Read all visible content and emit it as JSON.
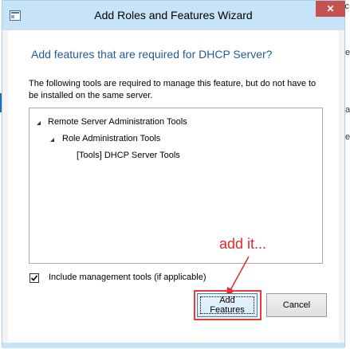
{
  "window": {
    "title": "Add Roles and Features Wizard",
    "close_glyph": "✕"
  },
  "dialog": {
    "heading": "Add features that are required for DHCP Server?",
    "description": "The following tools are required to manage this feature, but do not have to be installed on the same server.",
    "tree": [
      {
        "label": "Remote Server Administration Tools",
        "expanded": true
      },
      {
        "label": "Role Administration Tools",
        "expanded": true
      },
      {
        "label": "[Tools] DHCP Server Tools"
      }
    ],
    "include_tools": {
      "label": "Include management tools (if applicable)",
      "checked": true
    },
    "add_button": "Add Features",
    "cancel_button": "Cancel"
  },
  "annotation": {
    "text": "add it...",
    "color": "#e8232a"
  },
  "background_fragments": [
    "ic",
    "e",
    "a",
    "e"
  ],
  "colors": {
    "titlebar": "#c7e3f7",
    "heading": "#1e5a9c",
    "close": "#c75050"
  },
  "icons": [
    "app-icon",
    "close-icon",
    "expand-arrow-icon",
    "checkmark-icon",
    "red-arrow"
  ]
}
